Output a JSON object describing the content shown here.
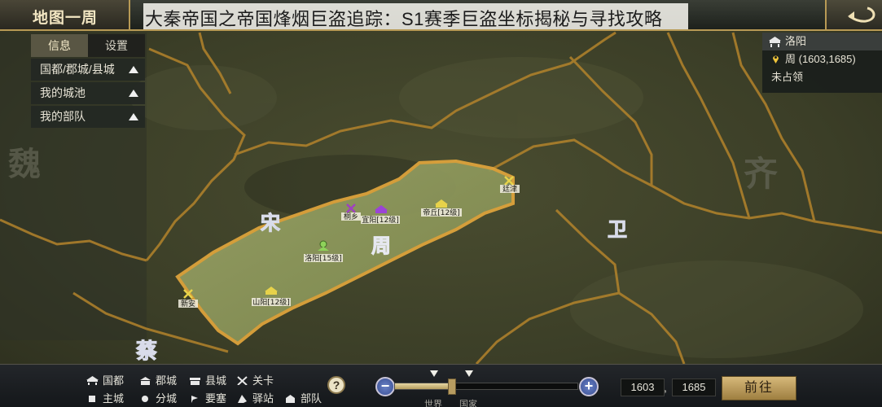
{
  "header": {
    "tab_title": "地图一周",
    "overlay_title": "大秦帝国之帝国烽烟巨盗追踪：S1赛季巨盗坐标揭秘与寻找攻略"
  },
  "left_panel": {
    "tabs": [
      {
        "label": "信息",
        "active": true
      },
      {
        "label": "设置",
        "active": false
      }
    ],
    "rows": [
      {
        "label": "国都/郡城/县城"
      },
      {
        "label": "我的城池"
      },
      {
        "label": "我的部队"
      }
    ]
  },
  "info_card": {
    "city_name": "洛阳",
    "location": "周 (1603,1685)",
    "status": "未占领"
  },
  "map": {
    "regions": [
      "魏",
      "宋",
      "周",
      "卫",
      "齐",
      "蔡"
    ],
    "places": [
      {
        "label": "桐乡",
        "kind": "pass",
        "color": "#a040c0"
      },
      {
        "label": "宜阳[12级]",
        "kind": "county",
        "color": "#9b44d6"
      },
      {
        "label": "帝丘[12级]",
        "kind": "county",
        "color": "#e7d24a"
      },
      {
        "label": "廷津",
        "kind": "pass",
        "color": "#e7d24a"
      },
      {
        "label": "洛阳[15级]",
        "kind": "capital",
        "color": "#8ed25a"
      },
      {
        "label": "新安",
        "kind": "pass",
        "color": "#e7d24a"
      },
      {
        "label": "山阳[12级]",
        "kind": "county",
        "color": "#e7d24a"
      }
    ]
  },
  "legend": {
    "items": [
      {
        "label": "国都",
        "icon": "capital-icon"
      },
      {
        "label": "郡城",
        "icon": "prefecture-icon"
      },
      {
        "label": "县城",
        "icon": "county-icon"
      },
      {
        "label": "关卡",
        "icon": "pass-icon"
      },
      {
        "label": "主城",
        "icon": "main-city-icon"
      },
      {
        "label": "分城",
        "icon": "branch-city-icon"
      },
      {
        "label": "要塞",
        "icon": "fortress-icon"
      },
      {
        "label": "驿站",
        "icon": "post-station-icon"
      },
      {
        "label": "部队",
        "icon": "troop-icon"
      }
    ]
  },
  "zoom": {
    "level": 0.31,
    "labels": [
      "世界",
      "国家"
    ]
  },
  "coords": {
    "x": "1603",
    "y": "1685",
    "separator": ","
  },
  "go_button": "前往",
  "colors": {
    "border_gold": "#d8a43a",
    "highlight_fill": "#8d9b5a",
    "gold_accent": "#b89a55"
  }
}
